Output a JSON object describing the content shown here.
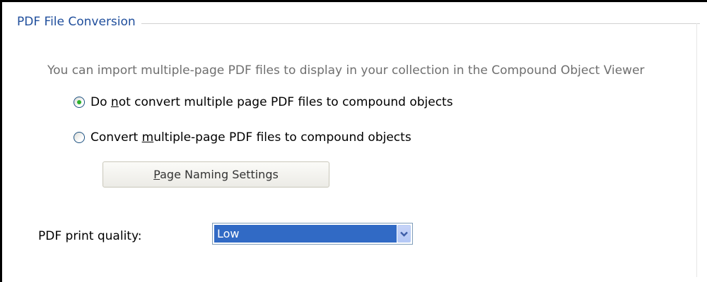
{
  "group": {
    "title": "PDF File Conversion"
  },
  "description": "You can import multiple-page PDF files to display in your collection in the Compound Object Viewer",
  "options": [
    {
      "label_prefix": "Do ",
      "label_mnemonic": "n",
      "label_suffix": "ot convert multiple page PDF files to compound objects",
      "selected": true
    },
    {
      "label_prefix": "Convert ",
      "label_mnemonic": "m",
      "label_suffix": "ultiple-page PDF files to compound objects",
      "selected": false
    }
  ],
  "page_naming_button": {
    "label_mnemonic": "P",
    "label_suffix": "age Naming Settings"
  },
  "print_quality": {
    "label": "PDF print quality:",
    "selected": "Low"
  },
  "icons": {
    "dropdown": "chevron-down-icon",
    "radio_selected": "radio-selected-icon",
    "radio_unselected": "radio-unselected-icon"
  },
  "colors": {
    "title": "#1f4e9c",
    "description": "#6f6f6f",
    "selection": "#316ac5",
    "radio_dot": "#2bb12b"
  }
}
